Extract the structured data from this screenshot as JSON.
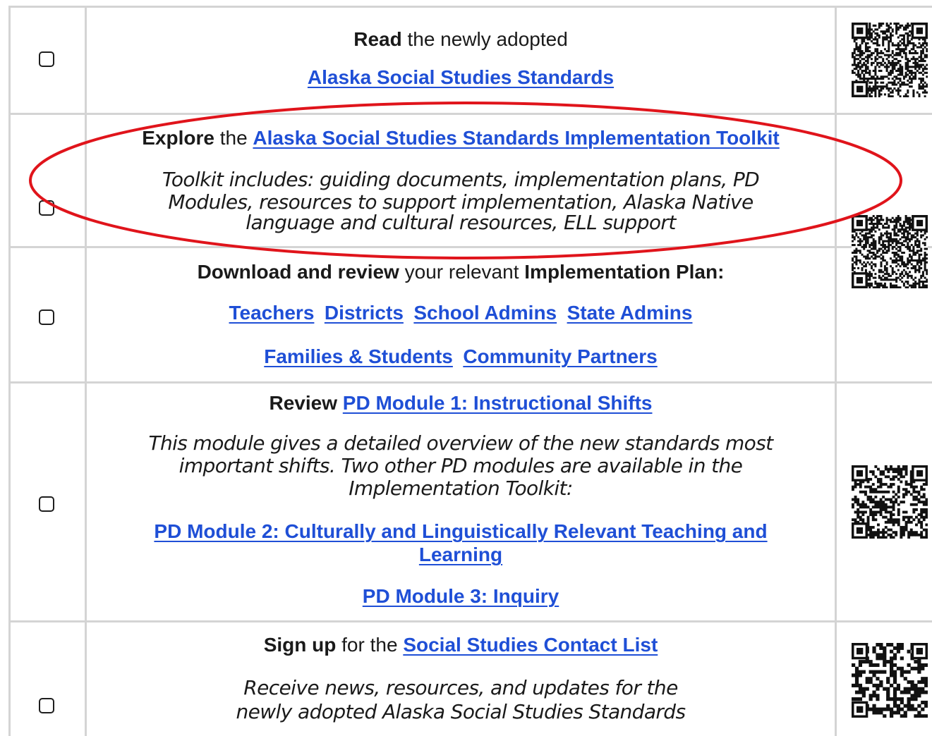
{
  "rows": [
    {
      "id": "read",
      "action_bold": "Read",
      "action_rest": " the newly adopted",
      "link": "Alaska Social Studies Standards"
    },
    {
      "id": "explore",
      "action_bold": "Explore",
      "action_rest": " the ",
      "link": "Alaska Social Studies Standards Implementation Toolkit",
      "desc_lines": [
        "Toolkit includes: guiding documents, implementation plans, PD",
        "Modules, resources to support implementation, Alaska Native",
        "language and cultural resources, ELL support"
      ]
    },
    {
      "id": "download",
      "action_bold": "Download and review",
      "action_rest": " your relevant ",
      "action_bold2": "Implementation Plan:",
      "links_line1": [
        "Teachers",
        "Districts",
        "School Admins",
        "State Admins"
      ],
      "links_line2": [
        "Families & Students",
        "Community Partners"
      ]
    },
    {
      "id": "review",
      "action_bold": "Review",
      "action_rest": " ",
      "link": "PD Module 1: Instructional Shifts",
      "desc_lines": [
        "This module gives a detailed overview of the new standards most",
        "important shifts. Two other PD modules are available in the",
        "Implementation Toolkit:"
      ],
      "link2_lines": [
        "PD Module 2: Culturally and Linguistically Relevant Teaching and",
        "Learning"
      ],
      "link3": "PD Module 3: Inquiry"
    },
    {
      "id": "signup",
      "action_bold": "Sign up",
      "action_rest": " for the ",
      "link": "Social Studies Contact List",
      "desc_lines": [
        "Receive news, resources, and updates for the",
        "newly adopted Alaska Social Studies Standards"
      ]
    }
  ],
  "colors": {
    "link": "#1f4fd6",
    "grid": "#d4d4d4",
    "annotation": "#e0141b"
  },
  "icons": [
    "checkbox-icon",
    "qr-code-icon"
  ]
}
